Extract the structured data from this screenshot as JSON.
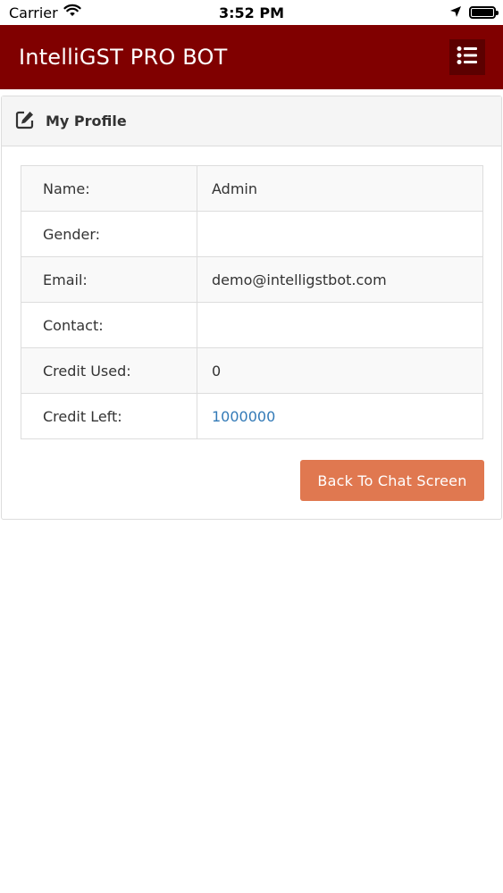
{
  "status_bar": {
    "carrier": "Carrier",
    "time": "3:52 PM",
    "icons": [
      "wifi-icon",
      "location-arrow-icon",
      "battery-icon"
    ]
  },
  "header": {
    "title": "IntelliGST PRO BOT",
    "menu_icon": "list-menu-icon",
    "background_color": "#800000"
  },
  "panel": {
    "title": "My Profile",
    "title_icon": "edit-icon"
  },
  "profile_rows": [
    {
      "label": "Name:",
      "value": "Admin"
    },
    {
      "label": "Gender:",
      "value": ""
    },
    {
      "label": "Email:",
      "value": "demo@intelligstbot.com"
    },
    {
      "label": "Contact:",
      "value": ""
    },
    {
      "label": "Credit Used:",
      "value": "0"
    },
    {
      "label": "Credit Left:",
      "value": "1000000"
    }
  ],
  "actions": {
    "back_label": "Back To Chat Screen",
    "back_color": "#e07850"
  }
}
